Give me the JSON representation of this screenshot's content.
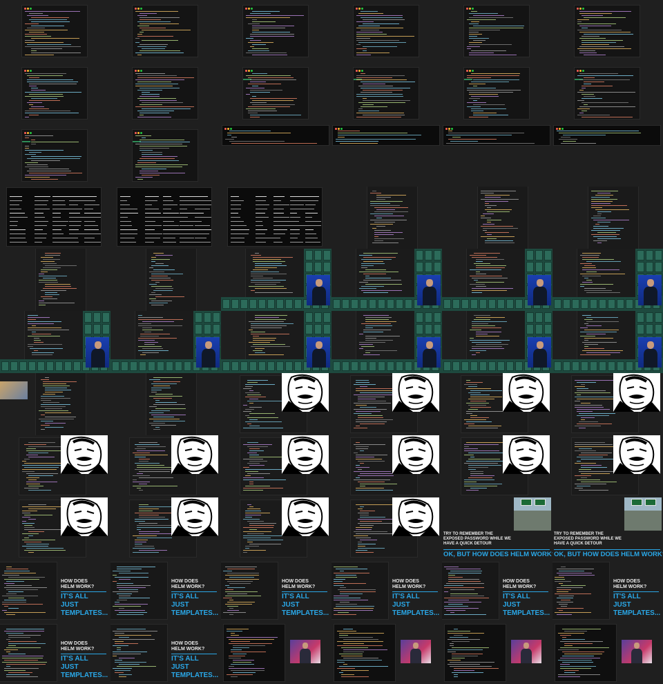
{
  "grid": {
    "columns": 6,
    "rows": 11
  },
  "frames": [
    {
      "kind": "editor",
      "tab": false
    },
    {
      "kind": "editor",
      "tab": false
    },
    {
      "kind": "editor",
      "tab": false
    },
    {
      "kind": "editor",
      "tab": false
    },
    {
      "kind": "editor",
      "tab": false
    },
    {
      "kind": "editor",
      "tab": false
    },
    {
      "kind": "editor",
      "tab": false
    },
    {
      "kind": "editor",
      "tab": false
    },
    {
      "kind": "editor",
      "tab": true
    },
    {
      "kind": "editor",
      "tab": true
    },
    {
      "kind": "editor",
      "tab": true
    },
    {
      "kind": "editor",
      "tab": true
    },
    {
      "kind": "editor",
      "tab": true
    },
    {
      "kind": "editor",
      "tab": true
    },
    {
      "kind": "terminal-wide"
    },
    {
      "kind": "terminal-wide"
    },
    {
      "kind": "terminal-wide"
    },
    {
      "kind": "terminal-wide"
    },
    {
      "kind": "terminal-table"
    },
    {
      "kind": "terminal-table"
    },
    {
      "kind": "terminal-table"
    },
    {
      "kind": "narrow-code"
    },
    {
      "kind": "narrow-code"
    },
    {
      "kind": "narrow-code"
    },
    {
      "kind": "narrow-code"
    },
    {
      "kind": "narrow-code"
    },
    {
      "kind": "speaker"
    },
    {
      "kind": "speaker"
    },
    {
      "kind": "speaker"
    },
    {
      "kind": "speaker"
    },
    {
      "kind": "speaker"
    },
    {
      "kind": "speaker"
    },
    {
      "kind": "speaker"
    },
    {
      "kind": "speaker"
    },
    {
      "kind": "speaker"
    },
    {
      "kind": "speaker"
    },
    {
      "kind": "code-thumb"
    },
    {
      "kind": "narrow-code"
    },
    {
      "kind": "meme"
    },
    {
      "kind": "meme"
    },
    {
      "kind": "meme"
    },
    {
      "kind": "meme"
    },
    {
      "kind": "meme"
    },
    {
      "kind": "meme"
    },
    {
      "kind": "meme"
    },
    {
      "kind": "meme"
    },
    {
      "kind": "meme"
    },
    {
      "kind": "meme"
    },
    {
      "kind": "meme"
    },
    {
      "kind": "meme"
    },
    {
      "kind": "meme"
    },
    {
      "kind": "meme"
    },
    {
      "kind": "detour"
    },
    {
      "kind": "detour"
    },
    {
      "kind": "helm"
    },
    {
      "kind": "helm"
    },
    {
      "kind": "helm"
    },
    {
      "kind": "helm"
    },
    {
      "kind": "helm"
    },
    {
      "kind": "helm"
    },
    {
      "kind": "helm"
    },
    {
      "kind": "helm"
    },
    {
      "kind": "editor-photo"
    },
    {
      "kind": "editor-photo"
    },
    {
      "kind": "editor-photo"
    },
    {
      "kind": "editor-photo"
    }
  ],
  "slides": {
    "detour": {
      "small": "TRY TO REMEMBER THE EXPOSED PASSWORD WHILE WE HAVE A QUICK DETOUR",
      "big": "OK, BUT HOW DOES HELM WORK?"
    },
    "helm": {
      "small": "HOW DOES HELM WORK?",
      "big": "IT'S ALL JUST TEMPLATES..."
    }
  },
  "colors": {
    "background": "#1f1f1f",
    "accent_blue": "#2aa8e8",
    "editor_green": "#2e8b57",
    "video_wall": "#1e4a3f"
  }
}
